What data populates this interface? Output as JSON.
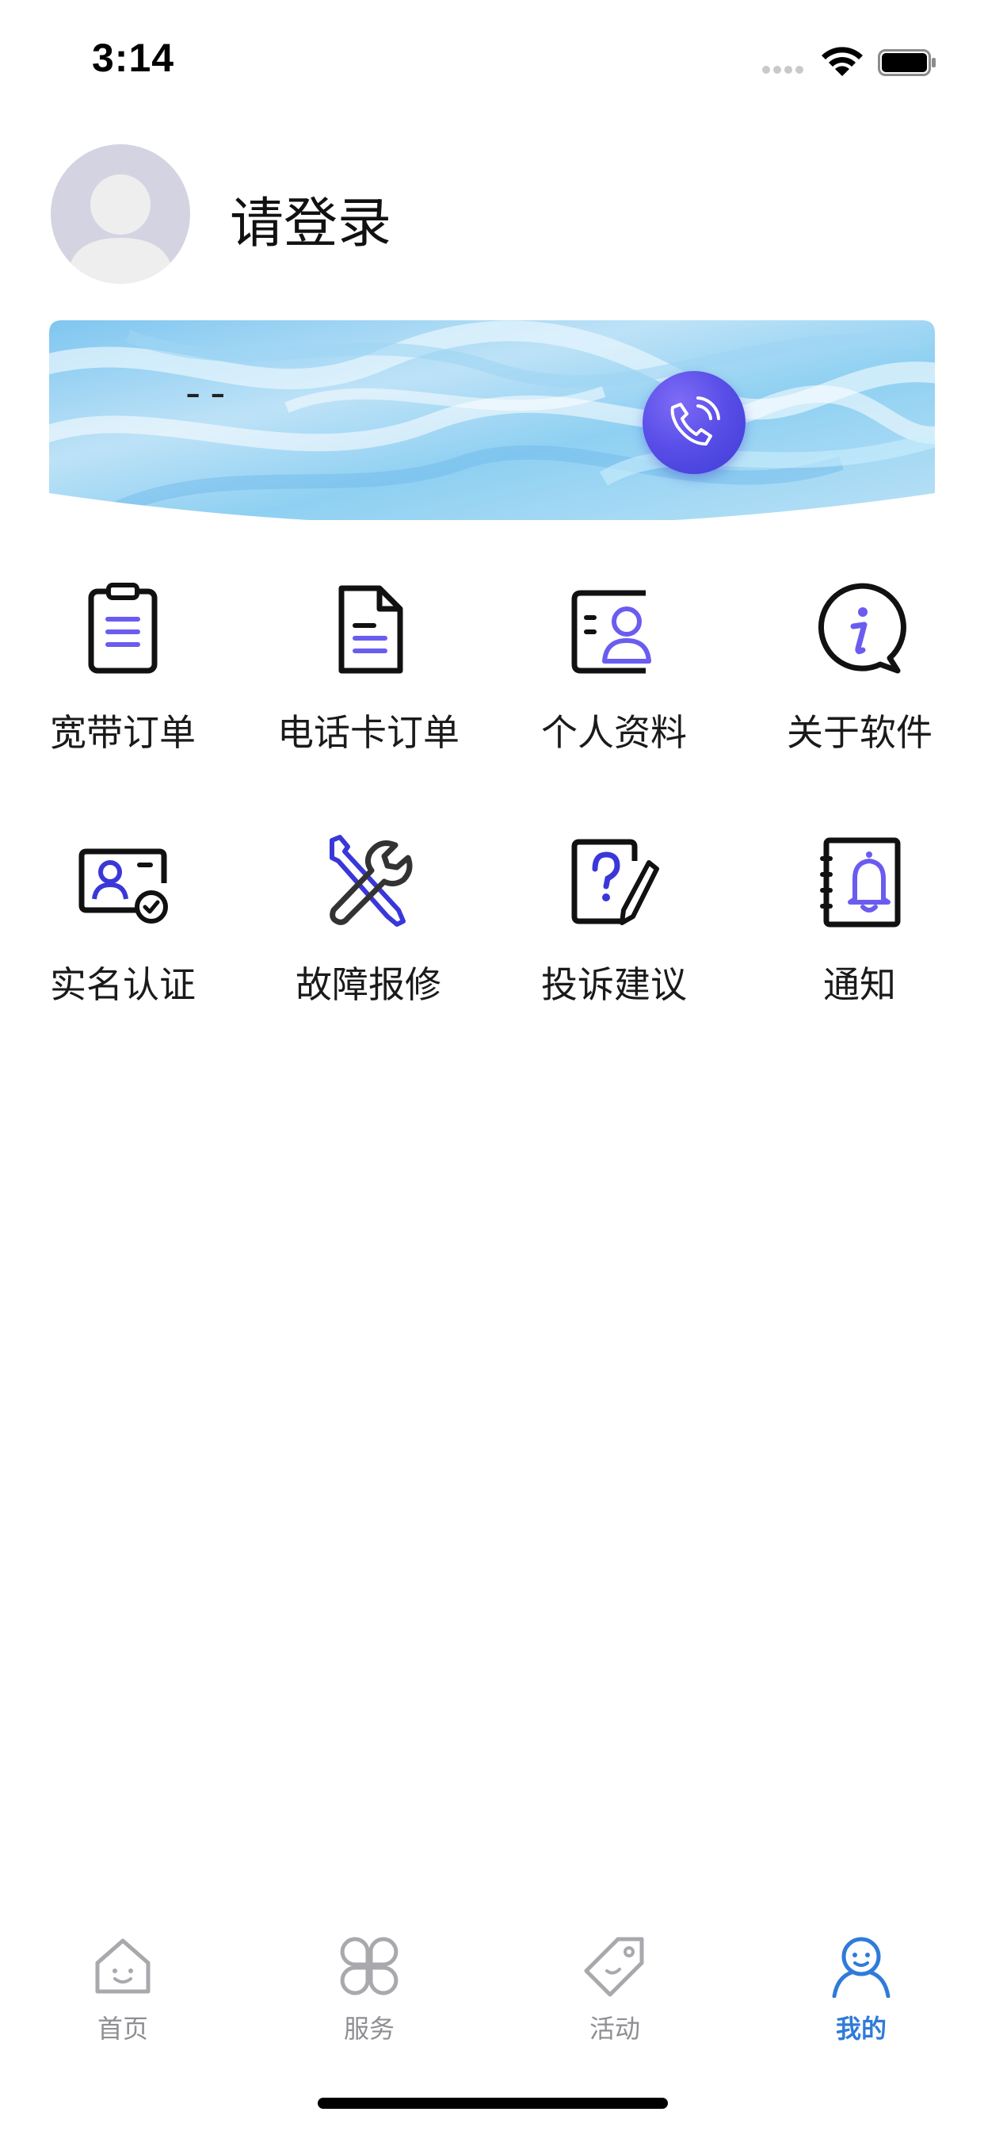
{
  "status_bar": {
    "time": "3:14"
  },
  "profile": {
    "login_label": "请登录"
  },
  "banner": {
    "value": "--",
    "phone_icon": "phone-call-icon"
  },
  "menu": [
    {
      "label": "宽带订单",
      "icon": "clipboard-icon"
    },
    {
      "label": "电话卡订单",
      "icon": "document-icon"
    },
    {
      "label": "个人资料",
      "icon": "profile-card-icon"
    },
    {
      "label": "关于软件",
      "icon": "info-bubble-icon"
    },
    {
      "label": "实名认证",
      "icon": "id-verify-icon"
    },
    {
      "label": "故障报修",
      "icon": "wrench-screwdriver-icon"
    },
    {
      "label": "投诉建议",
      "icon": "question-pen-icon"
    },
    {
      "label": "通知",
      "icon": "notification-bell-icon"
    }
  ],
  "tabbar": {
    "items": [
      {
        "label": "首页",
        "icon": "home-icon",
        "active": false
      },
      {
        "label": "服务",
        "icon": "clover-icon",
        "active": false
      },
      {
        "label": "活动",
        "icon": "tag-icon",
        "active": false
      },
      {
        "label": "我的",
        "icon": "person-icon",
        "active": true
      }
    ],
    "active_color": "#2f7bd9",
    "inactive_color": "#8e8e93"
  },
  "colors": {
    "accent_purple": "#6b5cf0",
    "phone_button": "#4a45e0"
  }
}
